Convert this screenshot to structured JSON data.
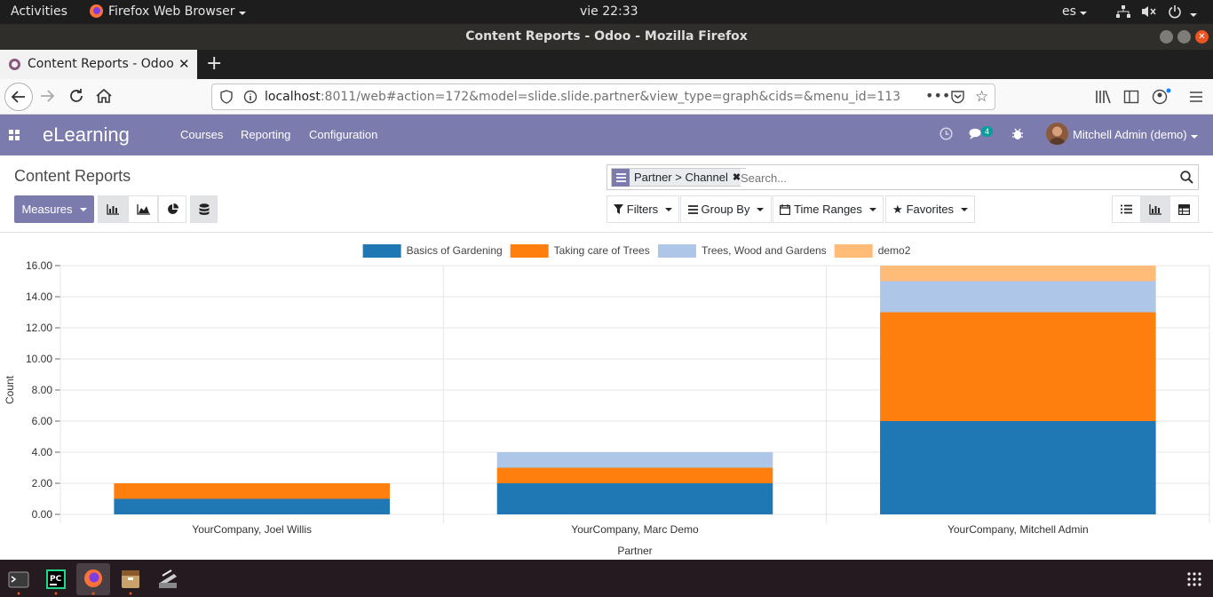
{
  "system": {
    "activities": "Activities",
    "app_name": "Firefox Web Browser",
    "clock": "vie 22:33",
    "lang": "es"
  },
  "window": {
    "title": "Content Reports - Odoo - Mozilla Firefox"
  },
  "browser": {
    "tab_title": "Content Reports - Odoo",
    "url_host": "localhost",
    "url_rest": ":8011/web#action=172&model=slide.slide.partner&view_type=graph&cids=&menu_id=113"
  },
  "odoo": {
    "app": "eLearning",
    "menu": [
      "Courses",
      "Reporting",
      "Configuration"
    ],
    "chat_count": "4",
    "user": "Mitchell Admin (demo)",
    "accent": "#7c7bad"
  },
  "control_panel": {
    "title": "Content Reports",
    "facet": "Partner > Channel",
    "search_placeholder": "Search...",
    "measures": "Measures",
    "filters": "Filters",
    "group_by": "Group By",
    "time_ranges": "Time Ranges",
    "favorites": "Favorites"
  },
  "chart_data": {
    "type": "bar",
    "stacked": true,
    "categories": [
      "YourCompany, Joel Willis",
      "YourCompany, Marc Demo",
      "YourCompany, Mitchell Admin"
    ],
    "series": [
      {
        "name": "Basics of Gardening",
        "color": "#1f77b4",
        "values": [
          1,
          2,
          6
        ]
      },
      {
        "name": "Taking care of Trees",
        "color": "#ff7f0e",
        "values": [
          1,
          1,
          7
        ]
      },
      {
        "name": "Trees, Wood and Gardens",
        "color": "#aec7e8",
        "values": [
          0,
          1,
          2
        ]
      },
      {
        "name": "demo2",
        "color": "#ffbb78",
        "values": [
          0,
          0,
          1
        ]
      }
    ],
    "xlabel": "Partner",
    "ylabel": "Count",
    "ylim": [
      0,
      16
    ],
    "yticks": [
      "0.00",
      "2.00",
      "4.00",
      "6.00",
      "8.00",
      "10.00",
      "12.00",
      "14.00",
      "16.00"
    ],
    "grid": true,
    "legend": "top"
  }
}
